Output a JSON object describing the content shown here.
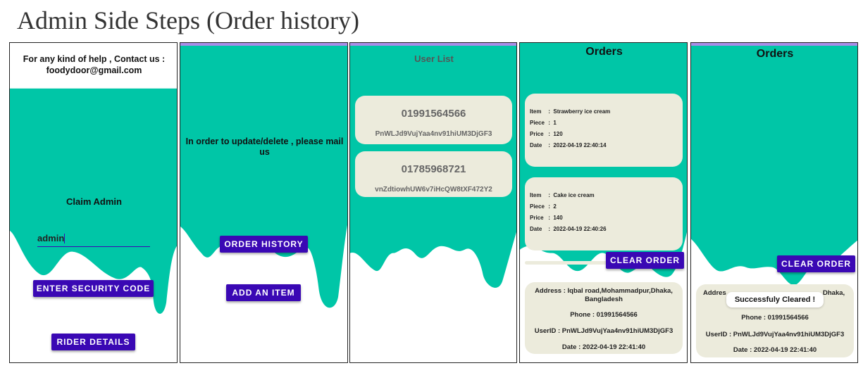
{
  "page_title": "Admin Side Steps (Order history)",
  "colors": {
    "teal": "#00c6a7",
    "button": "#3a08b4",
    "card": "#ecebdc",
    "strip": "#a98ce8"
  },
  "screen1": {
    "help_text": "For any kind of help , Contact us : foodydoor@gmail.com",
    "claim_title": "Claim Admin",
    "input_value": "admin",
    "enter_code_button": "ENTER SECURITY CODE",
    "rider_button": "RIDER DETAILS"
  },
  "screen2": {
    "message": "In order to update/delete , please mail us",
    "order_history_button": "ORDER HISTORY",
    "add_item_button": "ADD AN ITEM"
  },
  "screen3": {
    "title": "User List",
    "users": [
      {
        "phone": "01991564566",
        "id": "PnWLJd9VujYaa4nv91hiUM3DjGF3"
      },
      {
        "phone": "01785968721",
        "id": "vnZdtiowhUW6v7iHcQW8tXF472Y2"
      }
    ]
  },
  "screen4": {
    "title": "Orders",
    "orders": [
      {
        "item": "Strawberry ice cream",
        "piece": "1",
        "price": "120",
        "date": "2022-04-19 22:40:14"
      },
      {
        "item": "Cake ice cream",
        "piece": "2",
        "price": "140",
        "date": "2022-04-19 22:40:26"
      }
    ],
    "labels": {
      "item": "Item",
      "piece": "Piece",
      "price": "Price",
      "date": "Date",
      "sep": ":"
    },
    "clear_button": "CLEAR ORDER",
    "address": "Address : Iqbal road,Mohammadpur,Dhaka, Bangladesh",
    "phone": "Phone  : 01991564566",
    "userid": "UserID  : PnWLJd9VujYaa4nv91hiUM3DjGF3",
    "date": "Date   : 2022-04-19 22:41:40"
  },
  "screen5": {
    "title": "Orders",
    "clear_button": "CLEAR ORDER",
    "address_left": "Addres",
    "address_right": "Dhaka,",
    "toast": "Successfuly Cleared !",
    "phone": "Phone  : 01991564566",
    "userid": "UserID  : PnWLJd9VujYaa4nv91hiUM3DjGF3",
    "date": "Date   : 2022-04-19 22:41:40"
  }
}
